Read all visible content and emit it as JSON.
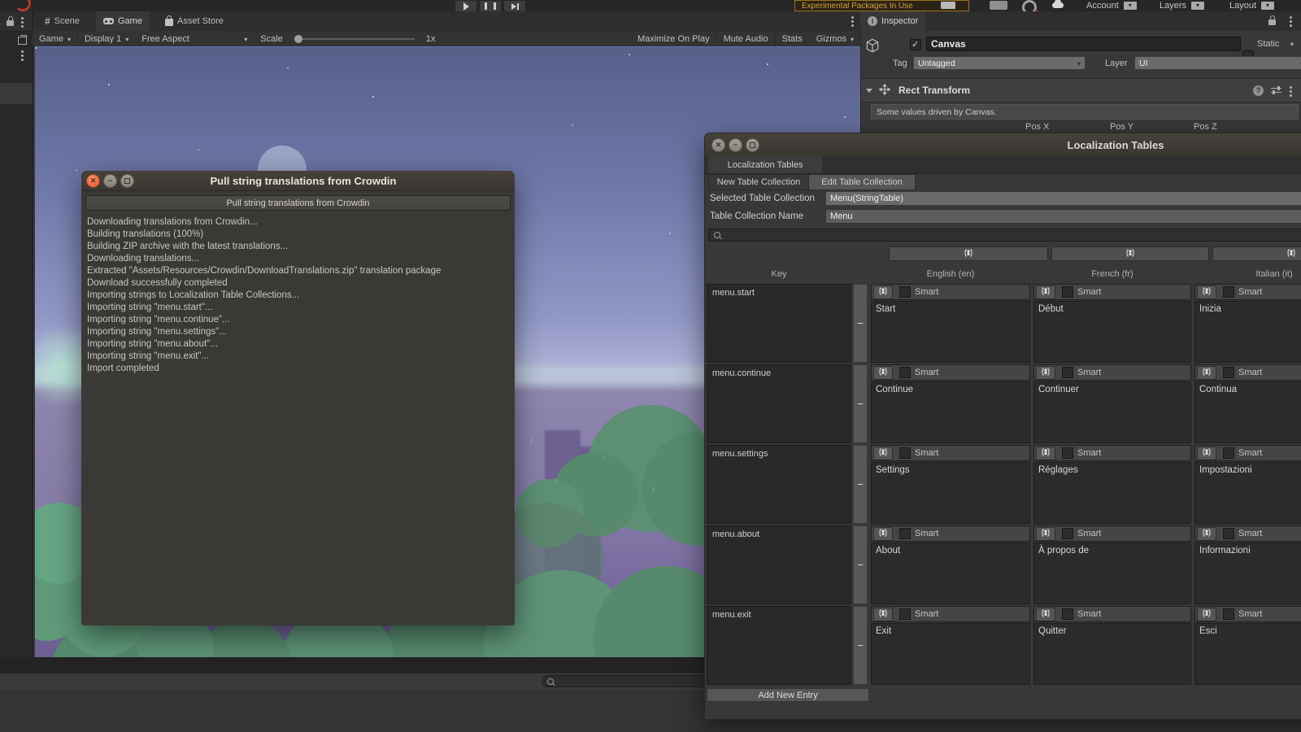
{
  "top_bar": {
    "experimental_label": "Experimental Packages In Use",
    "account_label": "Account",
    "layers_label": "Layers",
    "layout_label": "Layout"
  },
  "game_panel": {
    "tabs": [
      {
        "label": "Scene"
      },
      {
        "label": "Game"
      },
      {
        "label": "Asset Store"
      }
    ],
    "toolbar": {
      "display_target": "Game",
      "display": "Display 1",
      "aspect": "Free Aspect",
      "scale_label": "Scale",
      "scale_value": "1x",
      "maximize": "Maximize On Play",
      "mute": "Mute Audio",
      "stats": "Stats",
      "gizmos": "Gizmos"
    }
  },
  "inspector": {
    "tab": "Inspector",
    "object_name": "Canvas",
    "static_label": "Static",
    "tag_label": "Tag",
    "tag_value": "Untagged",
    "layer_label": "Layer",
    "layer_value": "UI",
    "component": "Rect Transform",
    "notice": "Some values driven by Canvas.",
    "pos_labels": [
      "Pos X",
      "Pos Y",
      "Pos Z"
    ]
  },
  "crowdin_dialog": {
    "title": "Pull string translations from Crowdin",
    "action_button": "Pull string translations from Crowdin",
    "log": [
      "Downloading translations from Crowdin...",
      "Building translations (100%)",
      "Building ZIP archive with the latest translations...",
      "Downloading translations...",
      "Extracted \"Assets/Resources/Crowdin/DownloadTranslations.zip\" translation package",
      "Download successfully completed",
      "Importing strings to Localization Table Collections...",
      "Importing string \"menu.start\"...",
      "Importing string \"menu.continue\"...",
      "Importing string \"menu.settings\"...",
      "Importing string \"menu.about\"...",
      "Importing string \"menu.exit\"...",
      "Import completed"
    ]
  },
  "loc_window": {
    "title": "Localization Tables",
    "tab": "Localization Tables",
    "new_button": "New Table Collection",
    "edit_button": "Edit Table Collection",
    "selected_label": "Selected Table Collection",
    "selected_value": "Menu(StringTable)",
    "name_label": "Table Collection Name",
    "name_value": "Menu",
    "table": {
      "key_header": "Key",
      "columns": [
        "English (en)",
        "French (fr)",
        "Italian (it)"
      ],
      "smart_label": "Smart",
      "remove_label": "−",
      "rows": [
        {
          "key": "menu.start",
          "en": "Start",
          "fr": "Début",
          "it": "Inizia"
        },
        {
          "key": "menu.continue",
          "en": "Continue",
          "fr": "Continuer",
          "it": "Continua"
        },
        {
          "key": "menu.settings",
          "en": "Settings",
          "fr": "Réglages",
          "it": "Impostazioni"
        },
        {
          "key": "menu.about",
          "en": "About",
          "fr": "À propos de",
          "it": "Informazioni"
        },
        {
          "key": "menu.exit",
          "en": "Exit",
          "fr": "Quitter",
          "it": "Esci"
        }
      ],
      "add_button": "Add New Entry"
    }
  },
  "colors": {
    "experimental_accent": "#d2a036",
    "close_button": "#e8643a",
    "sky_top": "#566089",
    "bush_green": "#5e9377"
  }
}
